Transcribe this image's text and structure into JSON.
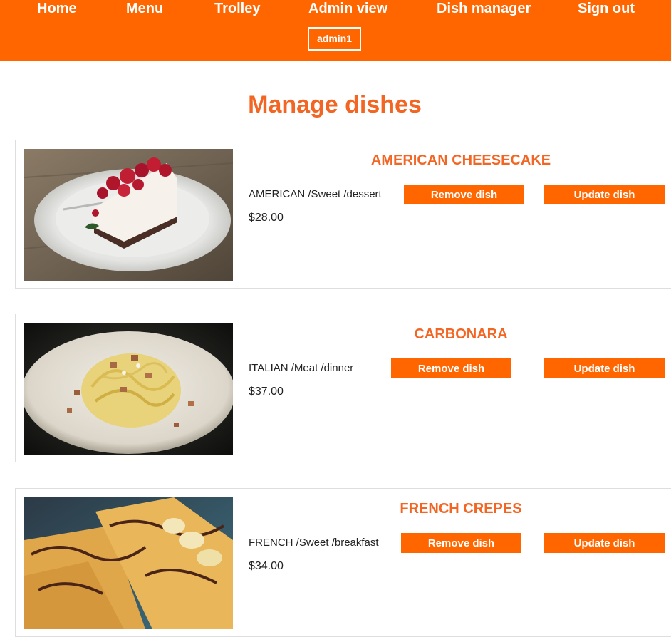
{
  "nav": {
    "home": "Home",
    "menu": "Menu",
    "trolley": "Trolley",
    "admin_view": "Admin view",
    "dish_manager": "Dish manager",
    "sign_out": "Sign out",
    "user": "admin1"
  },
  "page": {
    "title": "Manage dishes"
  },
  "dishes": [
    {
      "name": "AMERICAN CHEESECAKE",
      "category": "AMERICAN /Sweet /dessert",
      "price": "$28.00",
      "remove_label": "Remove dish",
      "update_label": "Update dish"
    },
    {
      "name": "CARBONARA",
      "category": "ITALIAN /Meat /dinner",
      "price": "$37.00",
      "remove_label": "Remove dish",
      "update_label": "Update dish"
    },
    {
      "name": "FRENCH CREPES",
      "category": "FRENCH /Sweet /breakfast",
      "price": "$34.00",
      "remove_label": "Remove dish",
      "update_label": "Update dish"
    }
  ],
  "colors": {
    "navbar": "#ff6600",
    "accent": "#f26522",
    "button": "#ff6600"
  }
}
